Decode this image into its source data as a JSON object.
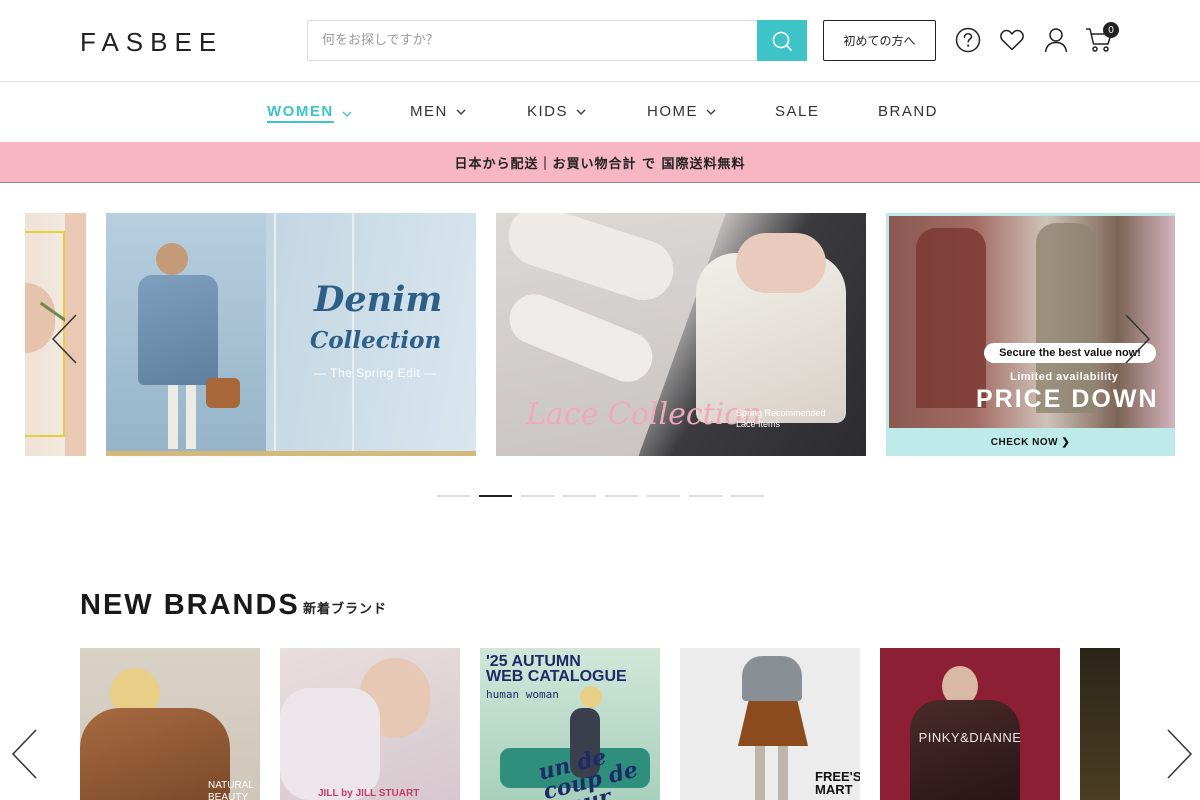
{
  "header": {
    "logo": "FASBEE",
    "search_placeholder": "何をお探しですか？",
    "first_time_label": "初めての方へ",
    "cart_count": "0"
  },
  "nav": {
    "items": [
      {
        "label": "WOMEN",
        "dropdown": true,
        "active": true
      },
      {
        "label": "MEN",
        "dropdown": true,
        "active": false
      },
      {
        "label": "KIDS",
        "dropdown": true,
        "active": false
      },
      {
        "label": "HOME",
        "dropdown": true,
        "active": false
      },
      {
        "label": "SALE",
        "dropdown": false,
        "active": false
      },
      {
        "label": "BRAND",
        "dropdown": false,
        "active": false
      }
    ]
  },
  "promo_text": "日本から配送｜お買い物合計 で 国際送料無料",
  "carousel": {
    "slides": [
      {
        "title_line1": "Denim",
        "title_line2": "Collection",
        "subtitle": "— The Spring Edit —"
      },
      {
        "title": "Lace Collection",
        "note_line1": "Spring Recommended",
        "note_line2": "Lace Items"
      },
      {
        "badge": "Secure the best value now!",
        "line1": "Limited availability",
        "headline": "PRICE DOWN",
        "cta": "CHECK NOW ❯"
      }
    ],
    "dots": 8,
    "active_dot": 1
  },
  "new_brands": {
    "title": "NEW BRANDS",
    "subtitle": "新着ブランド",
    "cards": [
      {
        "text": "NATURAL BEAUTY"
      },
      {
        "text": "JILL by JILL STUART"
      },
      {
        "line1": "'25 AUTUMN",
        "line2": "WEB CATALOGUE",
        "line3": "human woman",
        "script": "un de coup de cœur"
      },
      {
        "text": "FREE'S MART"
      },
      {
        "text": "PINKY&DIANNE"
      },
      {
        "text": ""
      }
    ]
  },
  "colors": {
    "accent": "#3ec3c9",
    "promo_bg": "#f6b6c4",
    "text": "#222222"
  }
}
